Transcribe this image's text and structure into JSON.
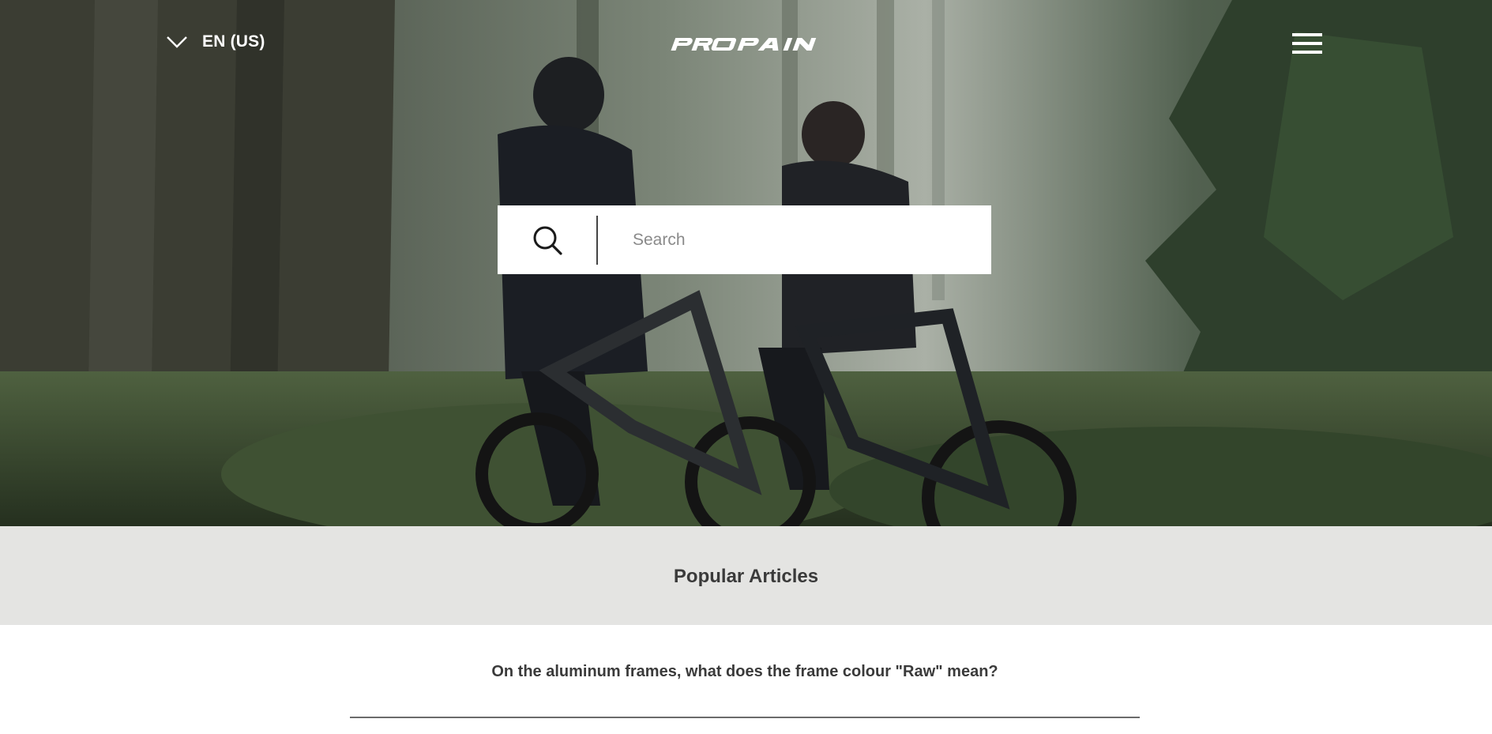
{
  "header": {
    "language_label": "EN (US)",
    "logo_text": "PROPAIN",
    "icons": {
      "language": "chevron-down-icon",
      "menu": "hamburger-menu-icon",
      "search": "search-icon"
    }
  },
  "search": {
    "placeholder": "Search",
    "value": ""
  },
  "popular": {
    "title": "Popular Articles",
    "articles": [
      {
        "title": "On the aluminum frames, what does the frame colour \"Raw\" mean?"
      }
    ]
  },
  "colors": {
    "band_background": "#e4e4e2",
    "heading_text": "#3a3a3a",
    "header_text": "#ffffff"
  }
}
